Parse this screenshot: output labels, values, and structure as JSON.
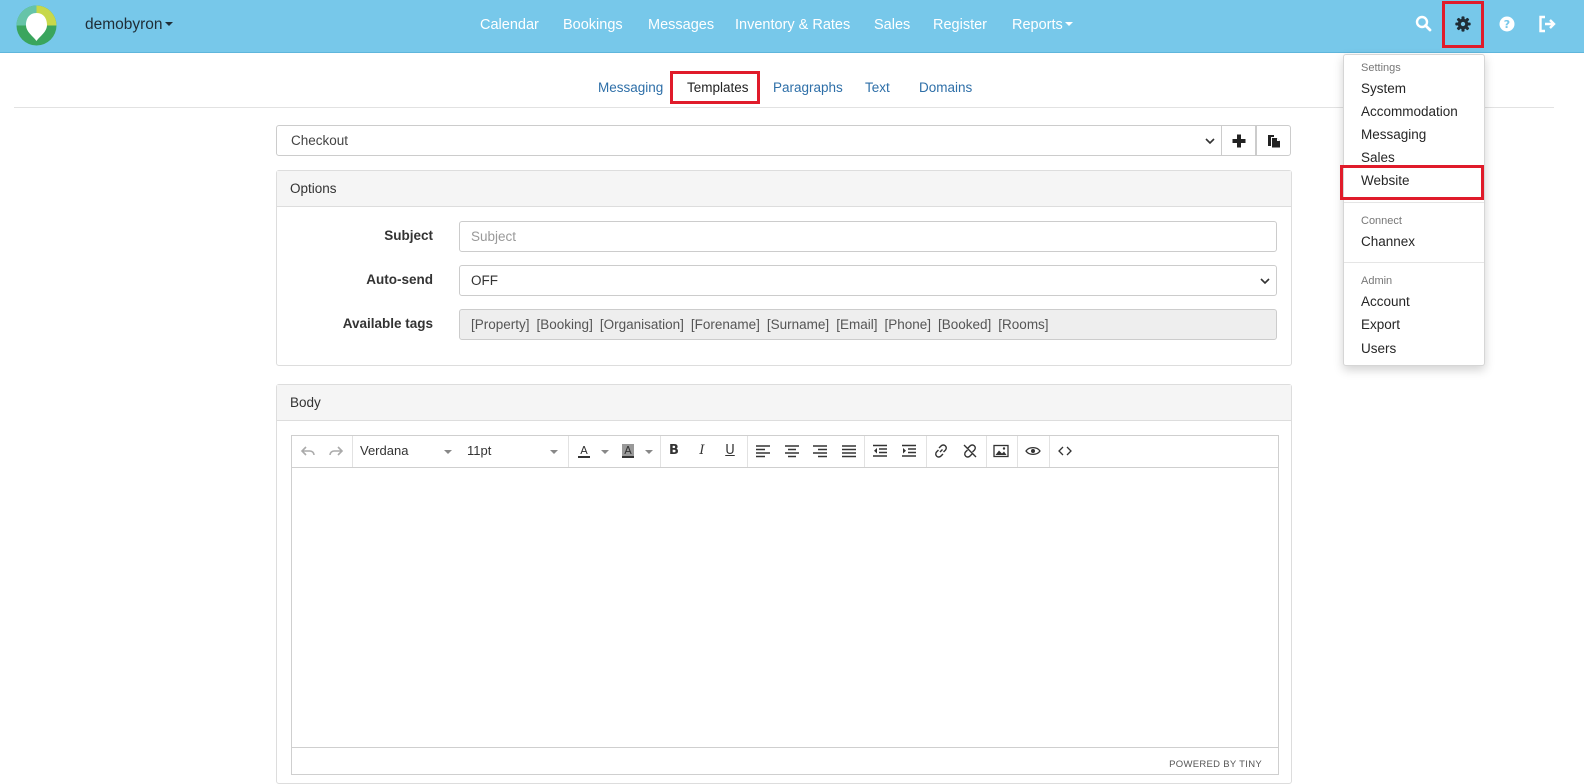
{
  "navbar": {
    "account_name": "demobyron",
    "links": [
      "Calendar",
      "Bookings",
      "Messages",
      "Inventory & Rates",
      "Sales",
      "Register",
      "Reports"
    ],
    "icons": [
      "search-icon",
      "gear-icon",
      "help-icon",
      "logout-icon"
    ],
    "bg_color": "#77c8ea"
  },
  "subtabs": {
    "items": [
      "Messaging",
      "Templates",
      "Paragraphs",
      "Text",
      "Domains"
    ],
    "active": "Templates"
  },
  "template_select": {
    "value": "Checkout"
  },
  "options_panel": {
    "title": "Options",
    "subject_label": "Subject",
    "subject_placeholder": "Subject",
    "autosend_label": "Auto-send",
    "autosend_value": "OFF",
    "tags_label": "Available tags",
    "tags": [
      "[Property]",
      "[Booking]",
      "[Organisation]",
      "[Forename]",
      "[Surname]",
      "[Email]",
      "[Phone]",
      "[Booked]",
      "[Rooms]"
    ]
  },
  "body_panel": {
    "title": "Body",
    "font_family": "Verdana",
    "font_size": "11pt",
    "powered_by": "POWERED BY TINY"
  },
  "settings_menu": {
    "settings_header": "Settings",
    "settings_items": [
      "System",
      "Accommodation",
      "Messaging",
      "Sales",
      "Website"
    ],
    "connect_header": "Connect",
    "connect_items": [
      "Channex"
    ],
    "admin_header": "Admin",
    "admin_items": [
      "Account",
      "Export",
      "Users"
    ],
    "highlight_color": "#e01b2a"
  }
}
